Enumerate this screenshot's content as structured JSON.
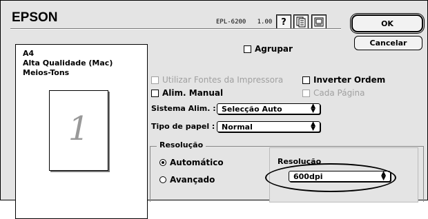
{
  "header": {
    "brand": "EPSON",
    "model": "EPL-6200",
    "version": "1.00",
    "icons": [
      "help-icon",
      "presets-icon",
      "layout-icon"
    ],
    "help_label": "?"
  },
  "actions": {
    "ok_label": "OK",
    "cancel_label": "Cancelar"
  },
  "summary": {
    "paper": "A4",
    "quality": "Alta Qualidade (Mac)",
    "halftone": "Meios-Tons",
    "page_number": "1"
  },
  "options": {
    "agrupar": {
      "label": "Agrupar",
      "checked": false,
      "enabled": true
    },
    "fontes": {
      "label": "Utilizar Fontes da Impressora",
      "checked": false,
      "enabled": false
    },
    "inverter": {
      "label": "Inverter Ordem",
      "checked": false,
      "enabled": true
    },
    "alim_manual": {
      "label": "Alim. Manual",
      "checked": false,
      "enabled": true
    },
    "cada_pagina": {
      "label": "Cada Página",
      "checked": false,
      "enabled": false
    }
  },
  "paper_source": {
    "label": "Sistema Alim. :",
    "value": "Selecção Auto"
  },
  "paper_type": {
    "label": "Tipo de papel :",
    "value": "Normal"
  },
  "resolution_group": {
    "title": "Resolução",
    "automatic_label": "Automático",
    "advanced_label": "Avançado",
    "selected": "Automático",
    "sub_label": "Resolução",
    "value": "600dpi"
  }
}
